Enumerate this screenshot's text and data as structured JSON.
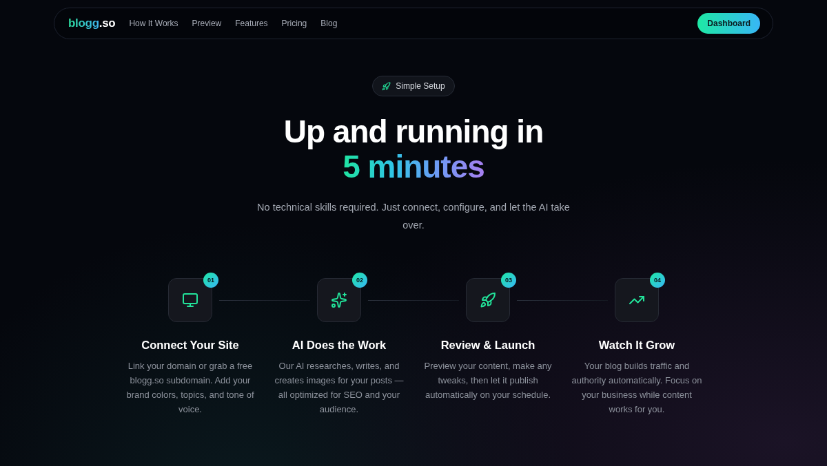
{
  "nav": {
    "logo": {
      "name": "blogg",
      "suffix": ".so"
    },
    "links": [
      "How It Works",
      "Preview",
      "Features",
      "Pricing",
      "Blog"
    ],
    "cta": "Dashboard"
  },
  "hero": {
    "badge": "Simple Setup",
    "title": "Up and running in",
    "highlight": "5 minutes",
    "subtitle": "No technical skills required. Just connect, configure, and let the AI take over."
  },
  "steps": [
    {
      "number": "01",
      "kind": "site",
      "title": "Connect Your Site",
      "text": "Link your domain or grab a free blogg.so subdomain. Add your brand colors, topics, and tone of voice."
    },
    {
      "number": "02",
      "kind": "ai",
      "title": "AI Does the Work",
      "text": "Our AI researches, writes, and creates images for your posts — all optimized for SEO and your audience."
    },
    {
      "number": "03",
      "kind": "launch",
      "title": "Review & Launch",
      "text": "Preview your content, make any tweaks, then let it publish automatically on your schedule."
    },
    {
      "number": "04",
      "kind": "growth",
      "title": "Watch It Grow",
      "text": "Your blog builds traffic and authority automatically. Focus on your business while content works for you."
    }
  ]
}
